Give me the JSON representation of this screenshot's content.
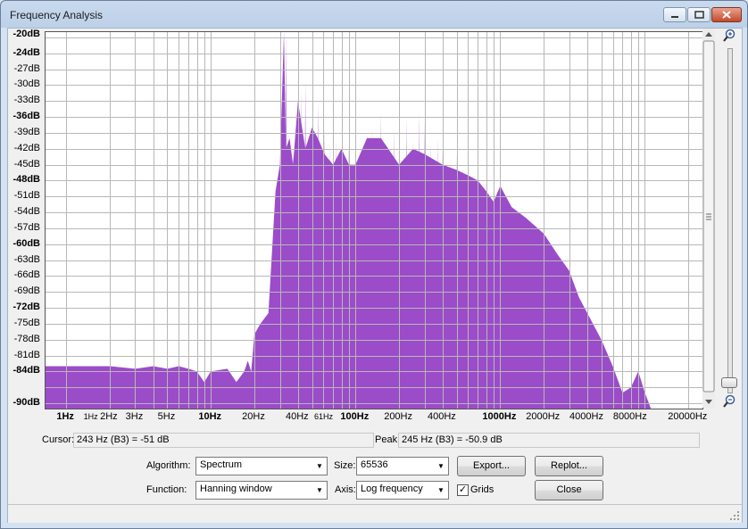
{
  "window": {
    "title": "Frequency Analysis",
    "controls": {
      "minimize": "minimize-icon",
      "maximize": "maximize-icon",
      "close": "close-icon"
    }
  },
  "plot": {
    "y_labels": [
      "-20dB",
      "-24dB",
      "-27dB",
      "-30dB",
      "-33dB",
      "-36dB",
      "-39dB",
      "-42dB",
      "-45dB",
      "-48dB",
      "-51dB",
      "-54dB",
      "-57dB",
      "-60dB",
      "-63dB",
      "-66dB",
      "-69dB",
      "-72dB",
      "-75dB",
      "-78dB",
      "-81dB",
      "-84dB",
      "-90dB"
    ],
    "x_labels": [
      {
        "text": "1Hz",
        "f": 1,
        "style": "bold"
      },
      {
        "text": "1Hz",
        "f": 1.5,
        "style": "small"
      },
      {
        "text": "2Hz",
        "f": 2,
        "style": "normal"
      },
      {
        "text": "3Hz",
        "f": 3,
        "style": "normal"
      },
      {
        "text": "5Hz",
        "f": 5,
        "style": "normal"
      },
      {
        "text": "10Hz",
        "f": 10,
        "style": "bold"
      },
      {
        "text": "20Hz",
        "f": 20,
        "style": "normal"
      },
      {
        "text": "40Hz",
        "f": 40,
        "style": "normal"
      },
      {
        "text": "61Hz",
        "f": 61,
        "style": "small"
      },
      {
        "text": "100Hz",
        "f": 100,
        "style": "bold"
      },
      {
        "text": "200Hz",
        "f": 200,
        "style": "normal"
      },
      {
        "text": "400Hz",
        "f": 400,
        "style": "normal"
      },
      {
        "text": "1000Hz",
        "f": 1000,
        "style": "bold"
      },
      {
        "text": "2000Hz",
        "f": 2000,
        "style": "normal"
      },
      {
        "text": "4000Hz",
        "f": 4000,
        "style": "normal"
      },
      {
        "text": "8000Hz",
        "f": 8000,
        "style": "normal"
      },
      {
        "text": "20000Hz",
        "f": 20000,
        "style": "normal"
      }
    ],
    "fill_color": "#9b4cc9",
    "grid_color": "#b8b8b8"
  },
  "chart_data": {
    "type": "area",
    "x_scale": "log",
    "xlim": [
      0.72,
      25000
    ],
    "ylim": [
      -91,
      -20
    ],
    "grid": true,
    "x_hz": [
      0.7,
      2,
      3,
      4,
      5,
      6,
      7,
      8,
      9,
      10,
      11,
      13,
      15,
      17,
      18,
      19,
      20,
      22,
      25,
      28,
      30,
      32,
      33,
      35,
      37,
      40,
      45,
      50,
      55,
      61,
      70,
      80,
      90,
      100,
      120,
      150,
      200,
      250,
      300,
      400,
      500,
      600,
      700,
      800,
      900,
      1000,
      1200,
      1500,
      2000,
      2500,
      3000,
      3500,
      4000,
      5000,
      6000,
      7000,
      8000,
      9000,
      10000,
      11000,
      13000,
      20000
    ],
    "envelope_db": [
      -83,
      -83,
      -83.5,
      -83,
      -83.5,
      -83,
      -83.5,
      -84,
      -86,
      -84,
      -83.8,
      -83.5,
      -86,
      -84,
      -82,
      -84,
      -77,
      -75,
      -73,
      -50,
      -45,
      -20,
      -42,
      -40,
      -45,
      -33,
      -42,
      -38,
      -40,
      -43,
      -45,
      -42,
      -45,
      -45,
      -40,
      -40,
      -45,
      -42,
      -43,
      -45,
      -46,
      -47,
      -48,
      -50,
      -52,
      -49,
      -53,
      -55,
      -58,
      -62,
      -65,
      -70,
      -73,
      -78,
      -83,
      -88,
      -87,
      -84,
      -88,
      -91,
      -91,
      -91
    ],
    "peaks": [
      {
        "f": 33,
        "db": -20
      },
      {
        "f": 35,
        "db": -42
      },
      {
        "f": 37,
        "db": -42
      },
      {
        "f": 42,
        "db": -31
      },
      {
        "f": 45,
        "db": -29
      },
      {
        "f": 50,
        "db": -37
      },
      {
        "f": 55,
        "db": -33
      },
      {
        "f": 61,
        "db": -38
      },
      {
        "f": 66,
        "db": -41
      },
      {
        "f": 73,
        "db": -40
      },
      {
        "f": 80,
        "db": -43
      },
      {
        "f": 90,
        "db": -41
      },
      {
        "f": 100,
        "db": -45
      },
      {
        "f": 130,
        "db": -38
      },
      {
        "f": 150,
        "db": -35
      },
      {
        "f": 165,
        "db": -42
      },
      {
        "f": 185,
        "db": -38
      },
      {
        "f": 200,
        "db": -39
      },
      {
        "f": 225,
        "db": -36
      },
      {
        "f": 250,
        "db": -40
      },
      {
        "f": 275,
        "db": -35
      },
      {
        "f": 300,
        "db": -37
      },
      {
        "f": 330,
        "db": -41
      },
      {
        "f": 370,
        "db": -40
      },
      {
        "f": 400,
        "db": -42
      },
      {
        "f": 450,
        "db": -44
      },
      {
        "f": 500,
        "db": -43
      },
      {
        "f": 550,
        "db": -45
      },
      {
        "f": 600,
        "db": -48
      },
      {
        "f": 700,
        "db": -47
      },
      {
        "f": 800,
        "db": -50
      },
      {
        "f": 900,
        "db": -49
      },
      {
        "f": 1000,
        "db": -48
      },
      {
        "f": 1100,
        "db": -52
      },
      {
        "f": 1200,
        "db": -53
      },
      {
        "f": 1400,
        "db": -58
      },
      {
        "f": 1600,
        "db": -59
      },
      {
        "f": 1800,
        "db": -61
      },
      {
        "f": 2200,
        "db": -67
      },
      {
        "f": 2600,
        "db": -68
      },
      {
        "f": 3000,
        "db": -70
      },
      {
        "f": 3500,
        "db": -73
      },
      {
        "f": 4000,
        "db": -75
      },
      {
        "f": 8000,
        "db": -87
      },
      {
        "f": 8400,
        "db": -87
      }
    ]
  },
  "readouts": {
    "cursor_label": "Cursor:",
    "cursor_value": "243 Hz (B3) = -51 dB",
    "peak_label": "Peak:",
    "peak_value": "245 Hz (B3) = -50.9 dB"
  },
  "controls": {
    "algorithm_label": "Algorithm:",
    "algorithm_value": "Spectrum",
    "size_label": "Size:",
    "size_value": "65536",
    "export_label": "Export...",
    "replot_label": "Replot...",
    "function_label": "Function:",
    "function_value": "Hanning window",
    "axis_label": "Axis:",
    "axis_value": "Log frequency",
    "grids_label": "Grids",
    "grids_checked": true,
    "close_label": "Close"
  }
}
